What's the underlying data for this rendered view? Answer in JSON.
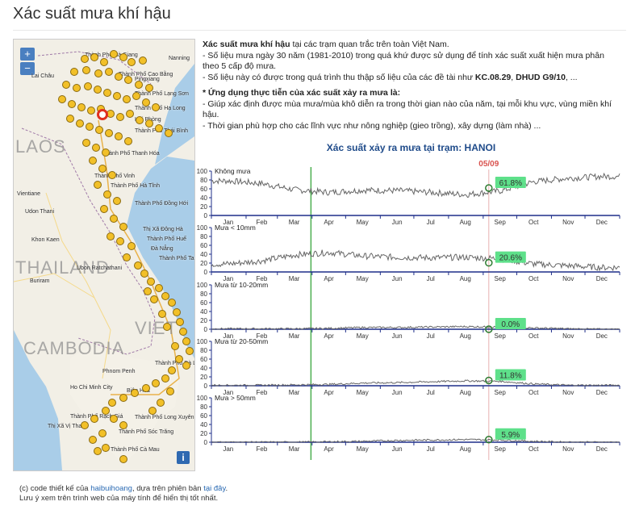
{
  "page": {
    "title": "Xác suất mưa khí hậu"
  },
  "map": {
    "zoom_in": "+",
    "zoom_out": "−",
    "info": "i",
    "region_labels": [
      "LAOS",
      "THAILAND",
      "CAMBODIA",
      "VIET"
    ],
    "place_labels": [
      "Thành Phố Hà Giang",
      "Thành Phố Cao Bằng",
      "Lai Châu",
      "Nanning",
      "Pingxiang",
      "Thành Phố Lạng Sơn",
      "Thành Phố Hạ Long",
      "Hải Phòng",
      "Thành Phố Thái Bình",
      "Thành Phố Thanh Hóa",
      "Thành Phố Vinh",
      "Thành Phố Hà Tĩnh",
      "Vientiane",
      "Thành Phố Đồng Hới",
      "Udon Thani",
      "Thị Xã Đông Hà",
      "Thành Phố Huế",
      "Khon Kaen",
      "Đà Nẵng",
      "Thành Phố Tam Kỳ",
      "Ubon Ratchathani",
      "Buriram",
      "Phnom Penh",
      "Ho Chi Minh City",
      "Biên Hòa",
      "Thành Phố Rạch Giá",
      "Thành Phố Long Xuyên",
      "Thị Xã Vị Thanh",
      "Thành Phố Sóc Trăng",
      "Thành Phố Cà Mau",
      "Thành Phố Đà Lạt"
    ]
  },
  "description": {
    "line1_bold": "Xác suất mưa khí hậu",
    "line1_rest": " tại các trạm quan trắc trên toàn Việt Nam.",
    "line2": "- Số liệu mưa ngày 30 năm (1981-2010) trong quá khứ được sử dụng để tính xác suất xuất hiện mưa phân theo 5 cấp độ mưa.",
    "line3_prefix": "- Số liệu này có được trong quá trình thu thập số liệu của các đề tài như ",
    "line3_bold1": "KC.08.29",
    "line3_sep": ", ",
    "line3_bold2": "DHUD G9/10",
    "line3_suffix": ", ...",
    "line4_bold": "* Ứng dụng thực tiễn của xác suất xảy ra mưa là:",
    "line5": "- Giúp xác định được mùa mưa/mùa khô diễn ra trong thời gian nào của năm, tại mỗi khu vực, vùng miền khí hậu.",
    "line6": "- Thời gian phù hợp cho các lĩnh vực như nông nghiệp (gieo trồng), xây dựng (làm nhà) ..."
  },
  "chart_data": {
    "type": "line",
    "title": "Xác suất xảy ra mưa tại trạm: HANOI",
    "current_date": "05/09",
    "months": [
      "Jan",
      "Feb",
      "Mar",
      "Apr",
      "May",
      "Jun",
      "Jul",
      "Aug",
      "Sep",
      "Oct",
      "Nov",
      "Dec"
    ],
    "yticks": [
      0,
      20,
      40,
      60,
      80,
      100
    ],
    "ylim": [
      0,
      100
    ],
    "highlight_day": 248,
    "green_marker_day": 89,
    "panels": [
      {
        "name": "Không mưa",
        "value_label": "61.8%",
        "current_value": 61.8,
        "monthly": [
          78,
          72,
          58,
          52,
          57,
          56,
          52,
          47,
          55,
          76,
          84,
          88
        ]
      },
      {
        "name": "Mưa < 10mm",
        "value_label": "20.6%",
        "current_value": 20.6,
        "monthly": [
          18,
          25,
          38,
          44,
          36,
          33,
          32,
          33,
          30,
          18,
          14,
          10
        ]
      },
      {
        "name": "Mưa từ 10-20mm",
        "value_label": "0.0%",
        "current_value": 0.0,
        "monthly": [
          1,
          1,
          1,
          2,
          4,
          4,
          5,
          6,
          5,
          3,
          1,
          0
        ]
      },
      {
        "name": "Mưa từ 20-50mm",
        "value_label": "11.8%",
        "current_value": 11.8,
        "monthly": [
          1,
          1,
          2,
          3,
          6,
          7,
          9,
          11,
          10,
          4,
          1,
          1
        ]
      },
      {
        "name": "Mưa > 50mm",
        "value_label": "5.9%",
        "current_value": 5.9,
        "monthly": [
          0,
          0,
          0,
          1,
          2,
          4,
          5,
          6,
          5,
          2,
          0,
          0
        ]
      }
    ]
  },
  "footer": {
    "credit_prefix": "(c) code thiết kế của ",
    "credit_link": "haibuihoang",
    "credit_middle": ", dựa trên phiên bản ",
    "credit_link2": "tại đây",
    "credit_end": ".",
    "note": "Lưu ý xem trên trình web của máy tính để hiển thị tốt nhất."
  },
  "colors": {
    "line": "#666666",
    "axis": "#1f2f8a",
    "highlight": "#d9534f",
    "marker": "#4caf50",
    "label_bg": "#5ee08a",
    "title": "#1f4b8a"
  }
}
